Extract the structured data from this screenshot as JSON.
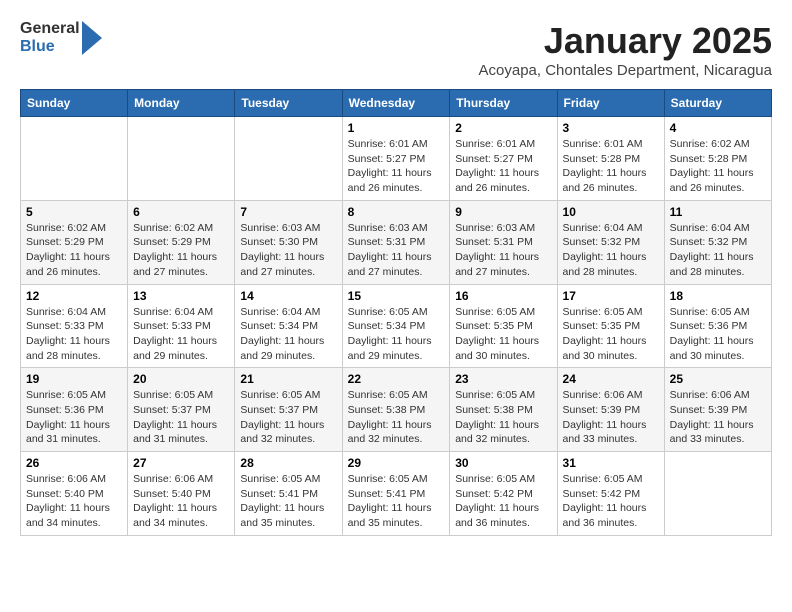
{
  "logo": {
    "text_general": "General",
    "text_blue": "Blue"
  },
  "title": "January 2025",
  "subtitle": "Acoyapa, Chontales Department, Nicaragua",
  "days_of_week": [
    "Sunday",
    "Monday",
    "Tuesday",
    "Wednesday",
    "Thursday",
    "Friday",
    "Saturday"
  ],
  "weeks": [
    [
      {
        "day": "",
        "info": ""
      },
      {
        "day": "",
        "info": ""
      },
      {
        "day": "",
        "info": ""
      },
      {
        "day": "1",
        "sunrise": "6:01 AM",
        "sunset": "5:27 PM",
        "daylight": "11 hours and 26 minutes."
      },
      {
        "day": "2",
        "sunrise": "6:01 AM",
        "sunset": "5:27 PM",
        "daylight": "11 hours and 26 minutes."
      },
      {
        "day": "3",
        "sunrise": "6:01 AM",
        "sunset": "5:28 PM",
        "daylight": "11 hours and 26 minutes."
      },
      {
        "day": "4",
        "sunrise": "6:02 AM",
        "sunset": "5:28 PM",
        "daylight": "11 hours and 26 minutes."
      }
    ],
    [
      {
        "day": "5",
        "sunrise": "6:02 AM",
        "sunset": "5:29 PM",
        "daylight": "11 hours and 26 minutes."
      },
      {
        "day": "6",
        "sunrise": "6:02 AM",
        "sunset": "5:29 PM",
        "daylight": "11 hours and 27 minutes."
      },
      {
        "day": "7",
        "sunrise": "6:03 AM",
        "sunset": "5:30 PM",
        "daylight": "11 hours and 27 minutes."
      },
      {
        "day": "8",
        "sunrise": "6:03 AM",
        "sunset": "5:31 PM",
        "daylight": "11 hours and 27 minutes."
      },
      {
        "day": "9",
        "sunrise": "6:03 AM",
        "sunset": "5:31 PM",
        "daylight": "11 hours and 27 minutes."
      },
      {
        "day": "10",
        "sunrise": "6:04 AM",
        "sunset": "5:32 PM",
        "daylight": "11 hours and 28 minutes."
      },
      {
        "day": "11",
        "sunrise": "6:04 AM",
        "sunset": "5:32 PM",
        "daylight": "11 hours and 28 minutes."
      }
    ],
    [
      {
        "day": "12",
        "sunrise": "6:04 AM",
        "sunset": "5:33 PM",
        "daylight": "11 hours and 28 minutes."
      },
      {
        "day": "13",
        "sunrise": "6:04 AM",
        "sunset": "5:33 PM",
        "daylight": "11 hours and 29 minutes."
      },
      {
        "day": "14",
        "sunrise": "6:04 AM",
        "sunset": "5:34 PM",
        "daylight": "11 hours and 29 minutes."
      },
      {
        "day": "15",
        "sunrise": "6:05 AM",
        "sunset": "5:34 PM",
        "daylight": "11 hours and 29 minutes."
      },
      {
        "day": "16",
        "sunrise": "6:05 AM",
        "sunset": "5:35 PM",
        "daylight": "11 hours and 30 minutes."
      },
      {
        "day": "17",
        "sunrise": "6:05 AM",
        "sunset": "5:35 PM",
        "daylight": "11 hours and 30 minutes."
      },
      {
        "day": "18",
        "sunrise": "6:05 AM",
        "sunset": "5:36 PM",
        "daylight": "11 hours and 30 minutes."
      }
    ],
    [
      {
        "day": "19",
        "sunrise": "6:05 AM",
        "sunset": "5:36 PM",
        "daylight": "11 hours and 31 minutes."
      },
      {
        "day": "20",
        "sunrise": "6:05 AM",
        "sunset": "5:37 PM",
        "daylight": "11 hours and 31 minutes."
      },
      {
        "day": "21",
        "sunrise": "6:05 AM",
        "sunset": "5:37 PM",
        "daylight": "11 hours and 32 minutes."
      },
      {
        "day": "22",
        "sunrise": "6:05 AM",
        "sunset": "5:38 PM",
        "daylight": "11 hours and 32 minutes."
      },
      {
        "day": "23",
        "sunrise": "6:05 AM",
        "sunset": "5:38 PM",
        "daylight": "11 hours and 32 minutes."
      },
      {
        "day": "24",
        "sunrise": "6:06 AM",
        "sunset": "5:39 PM",
        "daylight": "11 hours and 33 minutes."
      },
      {
        "day": "25",
        "sunrise": "6:06 AM",
        "sunset": "5:39 PM",
        "daylight": "11 hours and 33 minutes."
      }
    ],
    [
      {
        "day": "26",
        "sunrise": "6:06 AM",
        "sunset": "5:40 PM",
        "daylight": "11 hours and 34 minutes."
      },
      {
        "day": "27",
        "sunrise": "6:06 AM",
        "sunset": "5:40 PM",
        "daylight": "11 hours and 34 minutes."
      },
      {
        "day": "28",
        "sunrise": "6:05 AM",
        "sunset": "5:41 PM",
        "daylight": "11 hours and 35 minutes."
      },
      {
        "day": "29",
        "sunrise": "6:05 AM",
        "sunset": "5:41 PM",
        "daylight": "11 hours and 35 minutes."
      },
      {
        "day": "30",
        "sunrise": "6:05 AM",
        "sunset": "5:42 PM",
        "daylight": "11 hours and 36 minutes."
      },
      {
        "day": "31",
        "sunrise": "6:05 AM",
        "sunset": "5:42 PM",
        "daylight": "11 hours and 36 minutes."
      },
      {
        "day": "",
        "info": ""
      }
    ]
  ],
  "labels": {
    "sunrise": "Sunrise:",
    "sunset": "Sunset:",
    "daylight": "Daylight:"
  }
}
